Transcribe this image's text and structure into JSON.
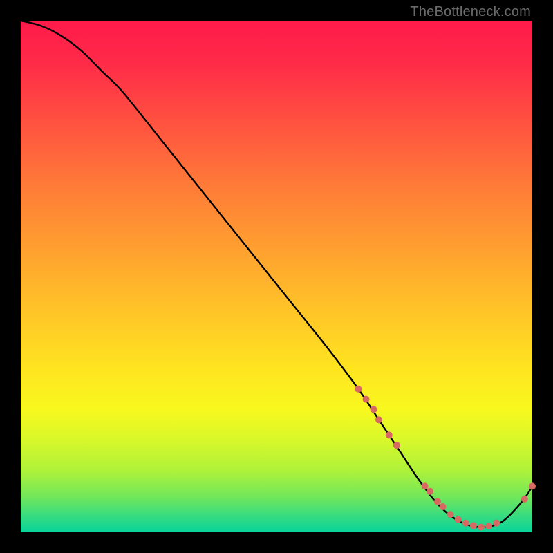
{
  "watermark": "TheBottleneck.com",
  "chart_data": {
    "type": "line",
    "title": "",
    "xlabel": "",
    "ylabel": "",
    "xlim": [
      0,
      100
    ],
    "ylim": [
      0,
      100
    ],
    "grid": false,
    "legend": false,
    "series": [
      {
        "name": "bottleneck-curve",
        "color": "#000000",
        "x": [
          0,
          4,
          8,
          12,
          16,
          20,
          28,
          36,
          44,
          52,
          60,
          66,
          70,
          74,
          78,
          82,
          86,
          90,
          94,
          98,
          100
        ],
        "y": [
          100,
          99,
          97,
          94,
          90,
          86,
          76,
          66,
          56,
          46,
          36,
          28,
          22,
          16,
          10,
          5,
          2,
          1,
          2,
          6,
          9
        ]
      }
    ],
    "markers": {
      "name": "highlight-points",
      "color": "#d66a63",
      "radius": 5,
      "points": [
        {
          "x": 66,
          "y": 28
        },
        {
          "x": 67.5,
          "y": 26
        },
        {
          "x": 69,
          "y": 24
        },
        {
          "x": 70,
          "y": 22
        },
        {
          "x": 72,
          "y": 19
        },
        {
          "x": 73.5,
          "y": 17
        },
        {
          "x": 79,
          "y": 9
        },
        {
          "x": 80,
          "y": 8
        },
        {
          "x": 81.5,
          "y": 6
        },
        {
          "x": 82.5,
          "y": 5
        },
        {
          "x": 84,
          "y": 3.5
        },
        {
          "x": 85.5,
          "y": 2.5
        },
        {
          "x": 87,
          "y": 1.8
        },
        {
          "x": 88.5,
          "y": 1.3
        },
        {
          "x": 90,
          "y": 1
        },
        {
          "x": 91.5,
          "y": 1.2
        },
        {
          "x": 93,
          "y": 1.8
        },
        {
          "x": 98.5,
          "y": 6.5
        },
        {
          "x": 100,
          "y": 9
        }
      ]
    },
    "background_gradient": {
      "direction": "vertical",
      "stops": [
        {
          "pos": 0,
          "color": "#ff1a4a"
        },
        {
          "pos": 50,
          "color": "#ffc228"
        },
        {
          "pos": 80,
          "color": "#f8f81e"
        },
        {
          "pos": 100,
          "color": "#08d39a"
        }
      ]
    }
  }
}
